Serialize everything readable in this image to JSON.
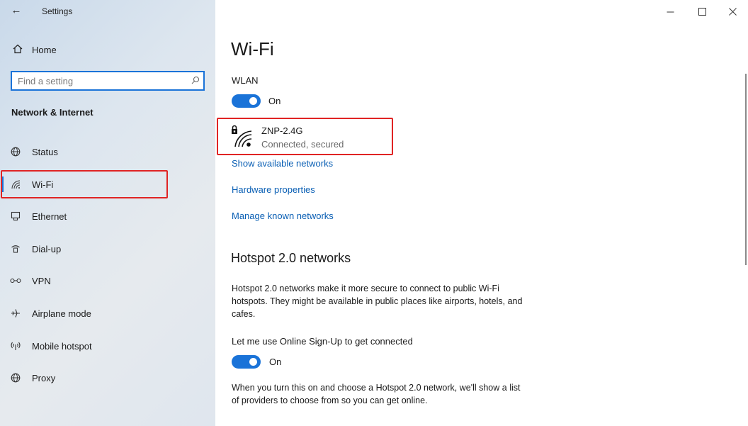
{
  "window": {
    "title": "Settings",
    "back_icon": "back-arrow-icon",
    "controls": {
      "minimize": "—",
      "maximize": "☐",
      "close": "✕"
    }
  },
  "sidebar": {
    "home_label": "Home",
    "search_placeholder": "Find a setting",
    "section_title": "Network & Internet",
    "items": [
      {
        "label": "Status",
        "icon": "globe-status-icon"
      },
      {
        "label": "Wi-Fi",
        "icon": "wifi-icon"
      },
      {
        "label": "Ethernet",
        "icon": "ethernet-icon"
      },
      {
        "label": "Dial-up",
        "icon": "dialup-icon"
      },
      {
        "label": "VPN",
        "icon": "vpn-icon"
      },
      {
        "label": "Airplane mode",
        "icon": "airplane-icon"
      },
      {
        "label": "Mobile hotspot",
        "icon": "hotspot-icon"
      },
      {
        "label": "Proxy",
        "icon": "globe-icon"
      }
    ]
  },
  "main": {
    "title": "Wi-Fi",
    "wlan_label": "WLAN",
    "wlan_toggle": "On",
    "network": {
      "name": "ZNP-2.4G",
      "status": "Connected, secured"
    },
    "links": [
      "Show available networks",
      "Hardware properties",
      "Manage known networks"
    ],
    "hotspot": {
      "heading": "Hotspot 2.0 networks",
      "description": "Hotspot 2.0 networks make it more secure to connect to public Wi-Fi hotspots. They might be available in public places like airports, hotels, and cafes.",
      "signup_label": "Let me use Online Sign-Up to get connected",
      "signup_toggle": "On",
      "footer": "When you turn this on and choose a Hotspot 2.0 network, we'll show a list of providers to choose from so you can get online."
    }
  },
  "colors": {
    "accent": "#1a73d8",
    "highlight": "#e02424",
    "link": "#0a5fb4"
  }
}
